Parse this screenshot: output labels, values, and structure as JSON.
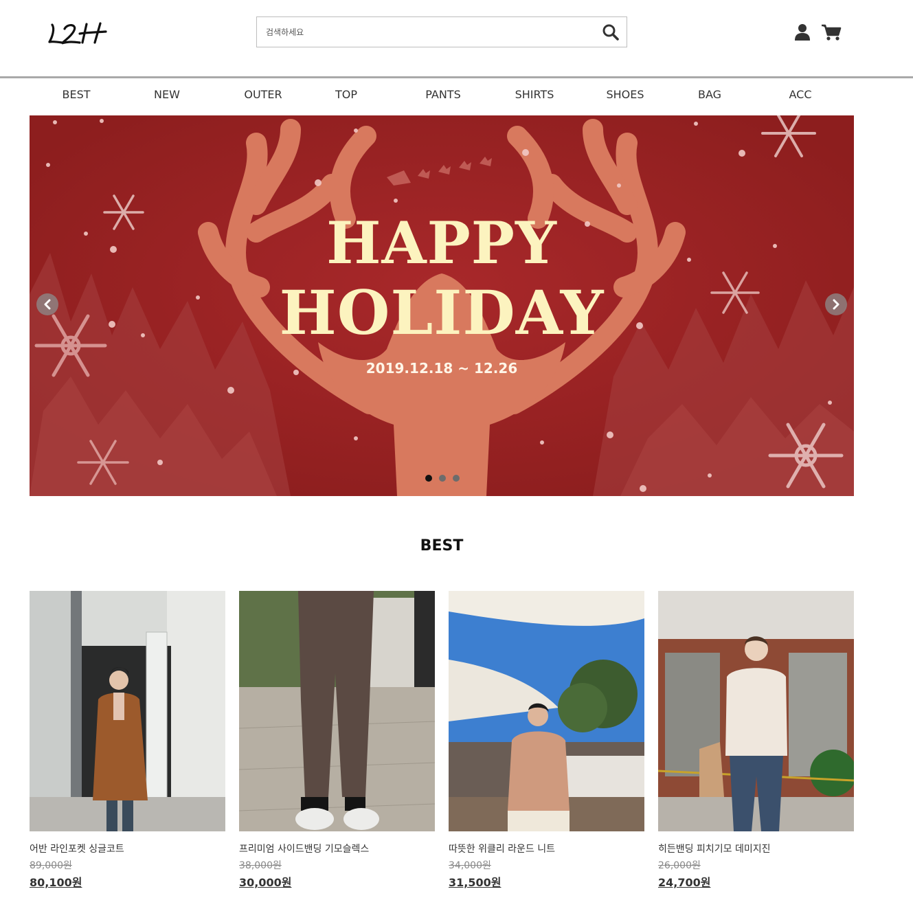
{
  "header": {
    "logo_text": "L2H",
    "search_placeholder": "검색하세요"
  },
  "nav": {
    "items": [
      "BEST",
      "NEW",
      "OUTER",
      "TOP",
      "PANTS",
      "SHIRTS",
      "SHOES",
      "BAG",
      "ACC"
    ]
  },
  "banner": {
    "title_line1": "HAPPY",
    "title_line2": "HOLIDAY",
    "date": "2019.12.18 ~ 12.26",
    "slide_count": 3,
    "active_slide": 1
  },
  "best": {
    "title": "BEST",
    "products": [
      {
        "name": "어반 라인포켓 싱글코트",
        "original_price": "89,000원",
        "sale_price": "80,100원"
      },
      {
        "name": "프리미엄 사이드밴딩 기모슬렉스",
        "original_price": "38,000원",
        "sale_price": "30,000원"
      },
      {
        "name": "따뜻한 위클리 라운드 니트",
        "original_price": "34,000원",
        "sale_price": "31,500원"
      },
      {
        "name": "히든밴딩 피치기모 데미지진",
        "original_price": "26,000원",
        "sale_price": "24,700원"
      }
    ]
  },
  "colors": {
    "banner_bg": "#9b2320",
    "antler": "#d8795e",
    "title_cream": "#fcf3bf",
    "divider": "#a9a9a9"
  },
  "icons": [
    "search-icon",
    "user-icon",
    "cart-icon",
    "chevron-left-icon",
    "chevron-right-icon"
  ]
}
